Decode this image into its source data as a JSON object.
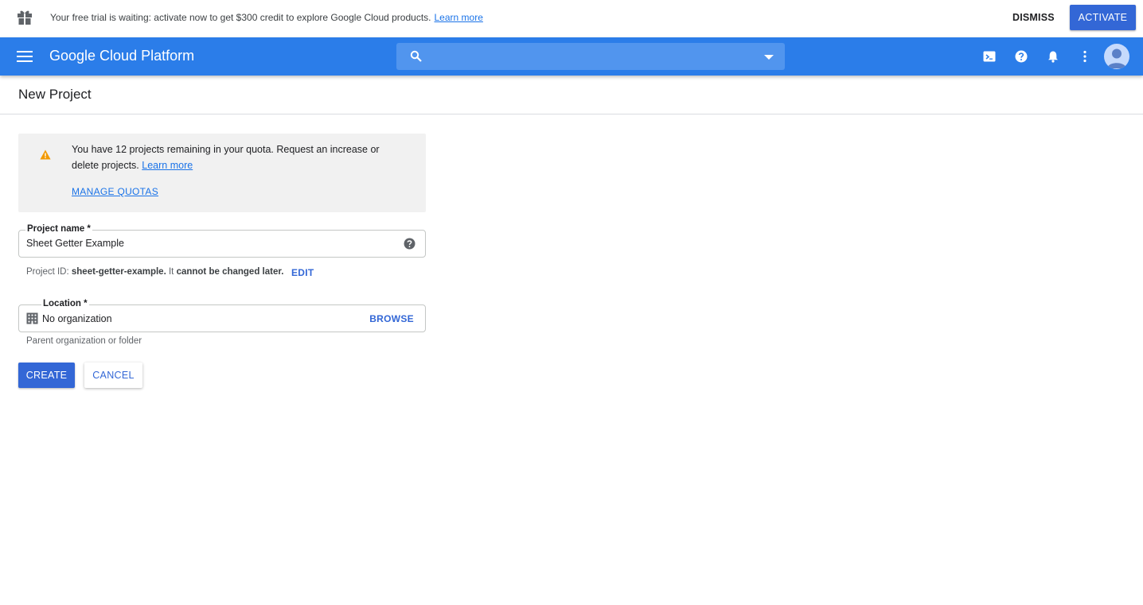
{
  "trial_banner": {
    "icon": "gift-icon",
    "message": "Your free trial is waiting: activate now to get $300 credit to explore Google Cloud products.",
    "learn_more": "Learn more",
    "dismiss": "DISMISS",
    "activate": "ACTIVATE"
  },
  "header": {
    "brand": "Google Cloud Platform",
    "search_placeholder": "",
    "icons": [
      "menu-icon",
      "search-icon",
      "cloud-shell-icon",
      "help-icon",
      "notifications-icon",
      "more-vert-icon",
      "account-avatar"
    ]
  },
  "page": {
    "title": "New Project"
  },
  "quota_notice": {
    "text": "You have 12 projects remaining in your quota. Request an increase or delete projects.",
    "learn_more": "Learn more",
    "manage_quotas": "MANAGE QUOTAS"
  },
  "form": {
    "project_name": {
      "label": "Project name *",
      "value": "Sheet Getter Example"
    },
    "project_id": {
      "prefix": "Project ID:",
      "id": "sheet-getter-example.",
      "middle": "It",
      "strong": "cannot be changed later.",
      "edit": "EDIT"
    },
    "location": {
      "label": "Location *",
      "value": "No organization",
      "browse": "BROWSE",
      "hint": "Parent organization or folder"
    },
    "create": "CREATE",
    "cancel": "CANCEL"
  },
  "colors": {
    "header_blue": "#2b7de9",
    "search_blue": "#5195ee",
    "primary_button": "#3367d6",
    "link": "#1a73e8",
    "warning": "#f29900"
  }
}
